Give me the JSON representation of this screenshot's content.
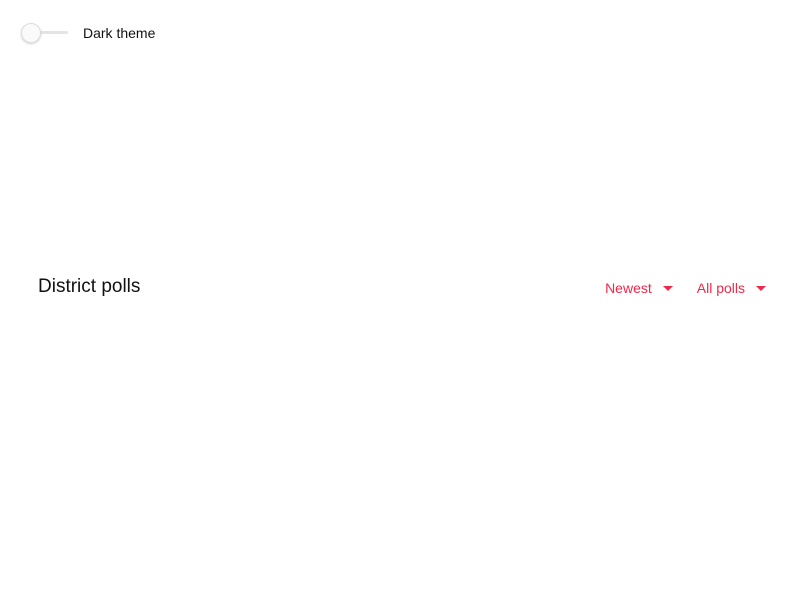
{
  "theme_toggle": {
    "label": "Dark theme",
    "checked": false
  },
  "polls": {
    "title": "District polls",
    "sort_select": {
      "selected": "Newest"
    },
    "filter_select": {
      "selected": "All polls"
    }
  },
  "colors": {
    "accent": "#f0284a",
    "text": "#111111",
    "background": "#ffffff"
  },
  "icons": {
    "sort_caret": "caret-down-icon",
    "filter_caret": "caret-down-icon"
  }
}
